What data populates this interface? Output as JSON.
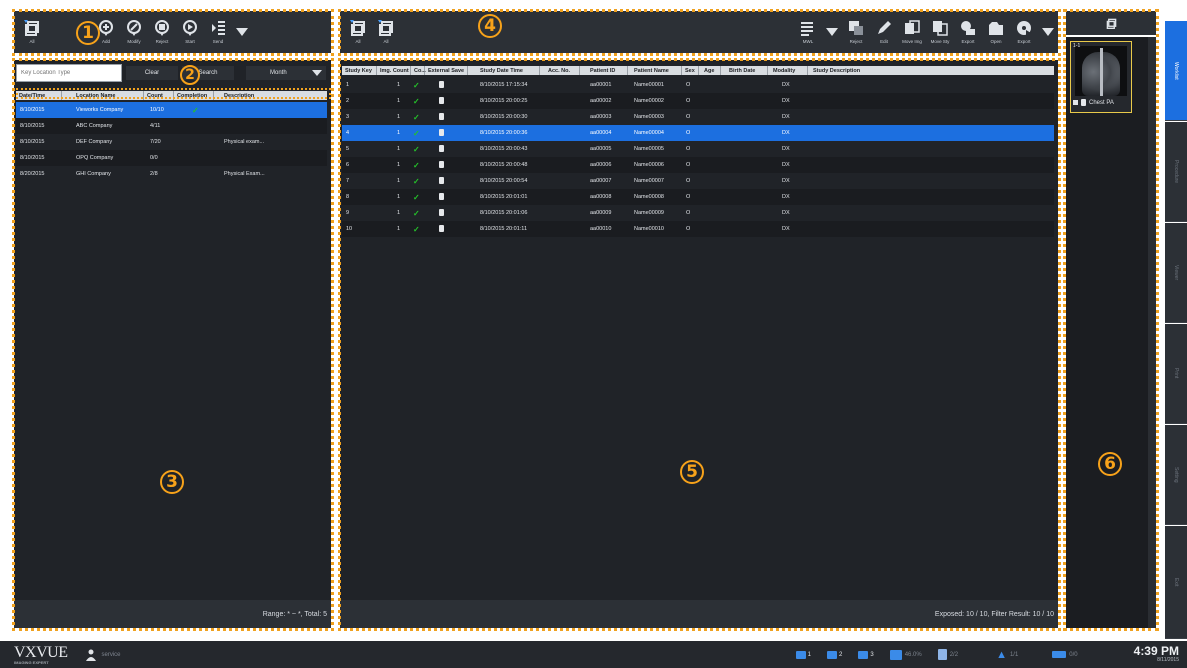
{
  "badges": [
    "1",
    "2",
    "3",
    "4",
    "5",
    "6"
  ],
  "toolbar1": {
    "buttons": [
      {
        "icon": "all-filter-icon",
        "label": "All"
      },
      {
        "icon": "add-icon",
        "label": "Add"
      },
      {
        "icon": "modify-icon",
        "label": "Modify"
      },
      {
        "icon": "reject-icon",
        "label": "Reject"
      },
      {
        "icon": "start-icon",
        "label": "Start"
      },
      {
        "icon": "send-icon",
        "label": "Send"
      }
    ]
  },
  "search": {
    "placeholder": "Key Location Type",
    "clear": "Clear",
    "search": "Search",
    "period": "Month"
  },
  "worklist": {
    "columns": [
      "Date/Time",
      "Location Name",
      "Count",
      "Completion",
      "Description"
    ],
    "rows": [
      {
        "date": "8/10/2015",
        "name": "Vieworks Company",
        "count": "10/10",
        "done": true,
        "desc": ""
      },
      {
        "date": "8/10/2015",
        "name": "ABC Company",
        "count": "4/11",
        "done": false,
        "desc": ""
      },
      {
        "date": "8/10/2015",
        "name": "DEF Company",
        "count": "7/20",
        "done": false,
        "desc": "Physical exam..."
      },
      {
        "date": "8/10/2015",
        "name": "OPQ Company",
        "count": "0/0",
        "done": false,
        "desc": ""
      },
      {
        "date": "8/20/2015",
        "name": "GHI Company",
        "count": "2/8",
        "done": false,
        "desc": "Physical Exam..."
      }
    ],
    "footer": "Range: * ~ *, Total: 5"
  },
  "toolbar4": {
    "left": [
      {
        "icon": "all-filter-icon",
        "label": "All"
      },
      {
        "icon": "all-filter-icon",
        "label": "All"
      }
    ],
    "right": [
      {
        "icon": "mwl-icon",
        "label": "MWL"
      },
      {
        "icon": "reject-icon",
        "label": "Reject"
      },
      {
        "icon": "edit-icon",
        "label": "Edit"
      },
      {
        "icon": "move-img-icon",
        "label": "Move Img"
      },
      {
        "icon": "move-sty-icon",
        "label": "Move Sty"
      },
      {
        "icon": "export-icon",
        "label": "Export"
      },
      {
        "icon": "open-icon",
        "label": "Open"
      },
      {
        "icon": "export-disc-icon",
        "label": "Export"
      }
    ]
  },
  "studies": {
    "columns": [
      "Study Key",
      "Img. Count",
      "Co...",
      "External Save",
      "Study Date Time",
      "Acc. No.",
      "Patient ID",
      "Patient Name",
      "Sex",
      "Age",
      "Birth Date",
      "Modality",
      "Study Description"
    ],
    "rows": [
      {
        "key": "1",
        "cnt": "1",
        "dt": "8/10/2015 17:15:34",
        "pid": "aa00001",
        "pname": "Name00001",
        "sex": "O",
        "mod": "DX"
      },
      {
        "key": "2",
        "cnt": "1",
        "dt": "8/10/2015 20:00:25",
        "pid": "aa00002",
        "pname": "Name00002",
        "sex": "O",
        "mod": "DX"
      },
      {
        "key": "3",
        "cnt": "1",
        "dt": "8/10/2015 20:00:30",
        "pid": "aa00003",
        "pname": "Name00003",
        "sex": "O",
        "mod": "DX"
      },
      {
        "key": "4",
        "cnt": "1",
        "dt": "8/10/2015 20:00:36",
        "pid": "aa00004",
        "pname": "Name00004",
        "sex": "O",
        "mod": "DX"
      },
      {
        "key": "5",
        "cnt": "1",
        "dt": "8/10/2015 20:00:43",
        "pid": "aa00005",
        "pname": "Name00005",
        "sex": "O",
        "mod": "DX"
      },
      {
        "key": "6",
        "cnt": "1",
        "dt": "8/10/2015 20:00:48",
        "pid": "aa00006",
        "pname": "Name00006",
        "sex": "O",
        "mod": "DX"
      },
      {
        "key": "7",
        "cnt": "1",
        "dt": "8/10/2015 20:00:54",
        "pid": "aa00007",
        "pname": "Name00007",
        "sex": "O",
        "mod": "DX"
      },
      {
        "key": "8",
        "cnt": "1",
        "dt": "8/10/2015 20:01:01",
        "pid": "aa00008",
        "pname": "Name00008",
        "sex": "O",
        "mod": "DX"
      },
      {
        "key": "9",
        "cnt": "1",
        "dt": "8/10/2015 20:01:06",
        "pid": "aa00009",
        "pname": "Name00009",
        "sex": "O",
        "mod": "DX"
      },
      {
        "key": "10",
        "cnt": "1",
        "dt": "8/10/2015 20:01:11",
        "pid": "aa00010",
        "pname": "Name00010",
        "sex": "O",
        "mod": "DX"
      }
    ],
    "footer": "Exposed: 10 / 10, Filter Result: 10 / 10"
  },
  "thumb": {
    "index": "1-1",
    "label": "Chest PA"
  },
  "tabs": [
    "Worklist",
    "Procedure",
    "Viewer",
    "Print",
    "Setting",
    "Exit"
  ],
  "status": {
    "logo": "VXVUE",
    "logo_sub": "IMAGING EXPERT",
    "user": "service",
    "slot1": "1",
    "slot2": "2",
    "slot3": "3",
    "disk": "46.0%",
    "detector": "2/2",
    "upload": "1/1",
    "printer": "0/0",
    "time": "4:39 PM",
    "date": "8/11/2015"
  },
  "colors": {
    "accent": "#1c6fe0",
    "annotation": "#f0a11e",
    "check": "#25c22a"
  }
}
